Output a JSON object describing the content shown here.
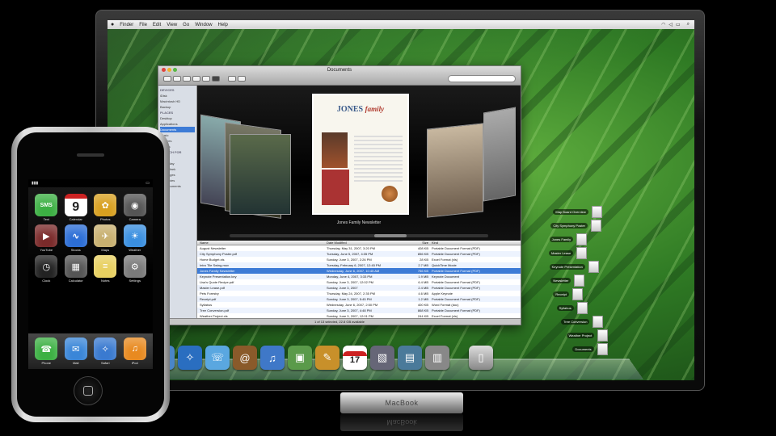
{
  "menubar": {
    "apple": "",
    "items": [
      "Finder",
      "File",
      "Edit",
      "View",
      "Go",
      "Window",
      "Help"
    ],
    "right_icons": [
      "wifi-icon",
      "volume-icon",
      "battery-icon"
    ],
    "clock": "",
    "spotlight": "search-icon"
  },
  "finder": {
    "title": "Documents",
    "search_placeholder": "",
    "sidebar": [
      {
        "label": "DEVICES",
        "header": true
      },
      {
        "label": "iDisk"
      },
      {
        "label": "Macintosh HD"
      },
      {
        "label": "Backup"
      },
      {
        "label": "PLACES",
        "header": true
      },
      {
        "label": "Desktop"
      },
      {
        "label": "Applications"
      },
      {
        "label": "Documents",
        "selected": true
      },
      {
        "label": "Music"
      },
      {
        "label": "Pictures"
      },
      {
        "label": "Movies"
      },
      {
        "label": "SEARCH FOR",
        "header": true
      },
      {
        "label": "Today"
      },
      {
        "label": "Yesterday"
      },
      {
        "label": "Past Week"
      },
      {
        "label": "All Images"
      },
      {
        "label": "All Movies"
      },
      {
        "label": "All Documents"
      }
    ],
    "coverflow": {
      "center_title": "JONES",
      "center_title_italic": "family",
      "label": "Jones Family Newsletter"
    },
    "columns": [
      "Name",
      "Date Modified",
      "Size",
      "Kind"
    ],
    "rows": [
      {
        "name": "August Newsletter",
        "date": "Thursday, May 31, 2007, 3:20 PM",
        "size": "408 KB",
        "kind": "Portable Document Format (PDF)"
      },
      {
        "name": "City Symphony Poster.pdf",
        "date": "Tuesday, June 5, 2007, 4:35 PM",
        "size": "856 KB",
        "kind": "Portable Document Format (PDF)"
      },
      {
        "name": "Home Budget.xls",
        "date": "Sunday, June 3, 2007, 2:26 PM",
        "size": "28 KB",
        "kind": "Excel Format (xls)"
      },
      {
        "name": "Intro Tile Swing.mov",
        "date": "Tuesday, February 6, 2007, 12:45 PM",
        "size": "2.7 MB",
        "kind": "QuickTime Movie"
      },
      {
        "name": "Jones Family Newsletter",
        "date": "Wednesday, June 6, 2007, 10:45 AM",
        "size": "756 KB",
        "kind": "Portable Document Format (PDF)",
        "selected": true
      },
      {
        "name": "Keynote Presentation.key",
        "date": "Monday, June 4, 2007, 3:33 PM",
        "size": "1.9 MB",
        "kind": "Keynote Document"
      },
      {
        "name": "Lisa's Quote Recipe.pdf",
        "date": "Sunday, June 3, 2007, 12:02 PM",
        "size": "6.4 MB",
        "kind": "Portable Document Format (PDF)"
      },
      {
        "name": "Master Lease.pdf",
        "date": "Sunday, June 3, 2007",
        "size": "2.4 MB",
        "kind": "Portable Document Format (PDF)"
      },
      {
        "name": "Pets Forestry",
        "date": "Thursday, May 24, 2007, 2:35 PM",
        "size": "4.6 MB",
        "kind": "Apple Keynote"
      },
      {
        "name": "Receipt.pdf",
        "date": "Sunday, June 3, 2007, 5:45 PM",
        "size": "1.2 MB",
        "kind": "Portable Document Format (PDF)"
      },
      {
        "name": "Syllabus",
        "date": "Wednesday, June 6, 2007, 2:50 PM",
        "size": "400 KB",
        "kind": "Word Format (doc)"
      },
      {
        "name": "Tree Conversion.pdf",
        "date": "Sunday, June 3, 2007, 4:48 PM",
        "size": "868 KB",
        "kind": "Portable Document Format (PDF)"
      },
      {
        "name": "Weather Project.xls",
        "date": "Sunday, June 3, 2007, 12:01 PM",
        "size": "244 KB",
        "kind": "Excel Format (xls)"
      }
    ],
    "status": "1 of 13 selected, 22.8 GB available"
  },
  "stack": [
    "Map Board Overview",
    "City Symphony Poster",
    "Jones Family",
    "Master Lease",
    "Keynote Presentation",
    "Newsletter",
    "Receipt",
    "Syllabus",
    "Tree Conversion",
    "Weather Project",
    "Documents"
  ],
  "dock": [
    {
      "name": "finder-icon",
      "glyph": "☺",
      "color": "#3b7ad6"
    },
    {
      "name": "dashboard-icon",
      "glyph": "◔",
      "color": "#333"
    },
    {
      "name": "time-machine-icon",
      "glyph": "⟲",
      "color": "#1f3e6e"
    },
    {
      "name": "mail-icon",
      "glyph": "✉",
      "color": "#4a86c8"
    },
    {
      "name": "safari-icon",
      "glyph": "✧",
      "color": "#2a6ec0"
    },
    {
      "name": "ichat-icon",
      "glyph": "☏",
      "color": "#5aa7e0"
    },
    {
      "name": "address-book-icon",
      "glyph": "@",
      "color": "#8a5a2a"
    },
    {
      "name": "itunes-icon",
      "glyph": "♫",
      "color": "#3f78c8"
    },
    {
      "name": "iphoto-icon",
      "glyph": "▣",
      "color": "#5a9a4a"
    },
    {
      "name": "iwork-icon",
      "glyph": "✎",
      "color": "#c8902a"
    },
    {
      "name": "calendar-icon",
      "glyph": "17",
      "calendar": true
    },
    {
      "name": "preview-icon",
      "glyph": "▧",
      "color": "#667"
    },
    {
      "name": "photos-icon",
      "glyph": "▤",
      "color": "#4a7a9a"
    },
    {
      "name": "stack-icon",
      "glyph": "▥",
      "color": "#888"
    }
  ],
  "stand_label": "MacBook",
  "iphone": {
    "carrier": "",
    "time": "",
    "battery": "",
    "apps": [
      {
        "label": "Text",
        "glyph": "SMS",
        "color": "#3cb043"
      },
      {
        "label": "Calendar",
        "glyph": "9",
        "color": "#ffffff",
        "calendar": true
      },
      {
        "label": "Photos",
        "glyph": "✿",
        "color": "#d8a020"
      },
      {
        "label": "Camera",
        "glyph": "◉",
        "color": "#555"
      },
      {
        "label": "YouTube",
        "glyph": "▶",
        "color": "#7a2a2a"
      },
      {
        "label": "Stocks",
        "glyph": "∿",
        "color": "#2c6ed6"
      },
      {
        "label": "Maps",
        "glyph": "✈",
        "color": "#c8b070"
      },
      {
        "label": "Weather",
        "glyph": "☀",
        "color": "#3a8fe0"
      },
      {
        "label": "Clock",
        "glyph": "◷",
        "color": "#222"
      },
      {
        "label": "Calculator",
        "glyph": "▦",
        "color": "#555"
      },
      {
        "label": "Notes",
        "glyph": "≡",
        "color": "#e8d060"
      },
      {
        "label": "Settings",
        "glyph": "⚙",
        "color": "#7a7a7a"
      }
    ],
    "dock": [
      {
        "label": "Phone",
        "glyph": "☎",
        "color": "#3cb043"
      },
      {
        "label": "Mail",
        "glyph": "✉",
        "color": "#3a86d8"
      },
      {
        "label": "Safari",
        "glyph": "✧",
        "color": "#3a7ad0"
      },
      {
        "label": "iPod",
        "glyph": "♫",
        "color": "#e88a20"
      }
    ]
  }
}
